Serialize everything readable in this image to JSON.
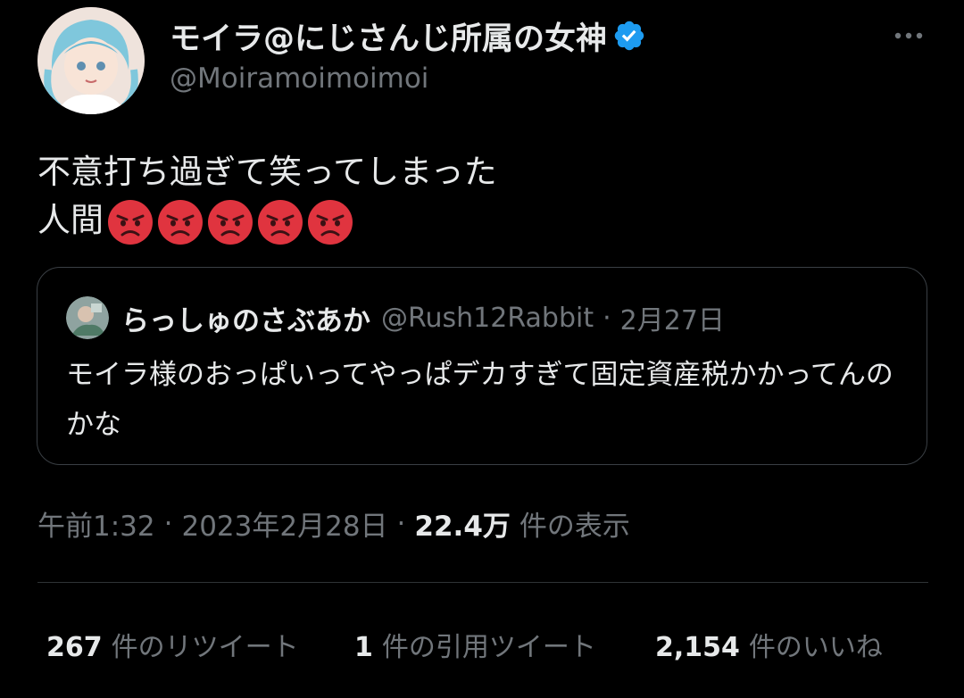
{
  "author": {
    "display_name": "モイラ@にじさんじ所属の女神",
    "handle": "@Moiramoimoimoi",
    "verified": true
  },
  "tweet": {
    "line1": "不意打ち過ぎて笑ってしまった",
    "line2": "人間",
    "emoji": [
      "pouting-face",
      "pouting-face",
      "pouting-face",
      "pouting-face",
      "pouting-face"
    ]
  },
  "quoted_tweet": {
    "display_name": "らっしゅのさぶあか",
    "handle": "@Rush12Rabbit",
    "separator": "·",
    "date": "2月27日",
    "text": "モイラ様のおっぱいってやっぱデカすぎて固定資産税かかってんのかな"
  },
  "meta": {
    "time": "午前1:32",
    "separator": "·",
    "date": "2023年2月28日",
    "separator2": "·",
    "views_count": "22.4万",
    "views_label": "件の表示"
  },
  "stats": {
    "retweets_count": "267",
    "retweets_label": "件のリツイート",
    "quotes_count": "1",
    "quotes_label": "件の引用ツイート",
    "likes_count": "2,154",
    "likes_label": "件のいいね"
  },
  "colors": {
    "background": "#000000",
    "text": "#e7e9ea",
    "secondary": "#71767b",
    "verified": "#1d9bf0",
    "border": "#2f3336",
    "emoji_red": "#e0343f"
  }
}
